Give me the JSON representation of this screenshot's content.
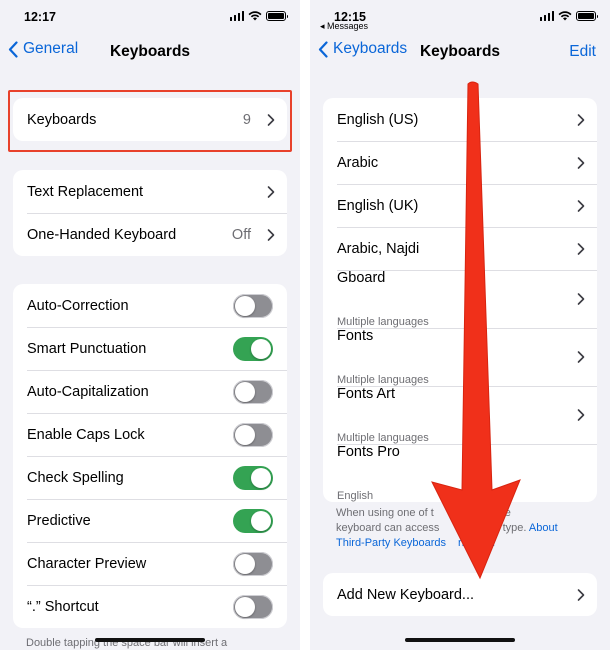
{
  "left": {
    "status_time": "12:17",
    "back_label": "General",
    "title": "Keyboards",
    "keyboards_row": {
      "label": "Keyboards",
      "value": "9"
    },
    "group2": [
      {
        "label": "Text Replacement",
        "value": ""
      },
      {
        "label": "One-Handed Keyboard",
        "value": "Off"
      }
    ],
    "toggles": [
      {
        "label": "Auto-Correction",
        "on": false
      },
      {
        "label": "Smart Punctuation",
        "on": true
      },
      {
        "label": "Auto-Capitalization",
        "on": false
      },
      {
        "label": "Enable Caps Lock",
        "on": false
      },
      {
        "label": "Check Spelling",
        "on": true
      },
      {
        "label": "Predictive",
        "on": true
      },
      {
        "label": "Character Preview",
        "on": false
      },
      {
        "label": "“.” Shortcut",
        "on": false
      }
    ],
    "footer_text": "Double tapping the space bar will insert a"
  },
  "right": {
    "status_time": "12:15",
    "status_sub": "◂ Messages",
    "back_label": "Keyboards",
    "title": "Keyboards",
    "edit_label": "Edit",
    "keyboards": [
      {
        "name": "English (US)",
        "sub": ""
      },
      {
        "name": "Arabic",
        "sub": ""
      },
      {
        "name": "English (UK)",
        "sub": ""
      },
      {
        "name": "Arabic, Najdi",
        "sub": ""
      },
      {
        "name": "Gboard",
        "sub": "Multiple languages"
      },
      {
        "name": "Fonts",
        "sub": "Multiple languages"
      },
      {
        "name": "Fonts Art",
        "sub": "Multiple languages"
      },
      {
        "name": "Fonts Pro",
        "sub": "English"
      }
    ],
    "footer_line1": "When using one of t",
    "footer_line1b": "boards, the",
    "footer_line2": "keyboard can access",
    "footer_line2b": "data you type.",
    "footer_link_about": "About",
    "footer_link": "Third-Party Keyboards",
    "footer_link_end": "rivacy...",
    "add_label": "Add New Keyboard..."
  },
  "colors": {
    "accent": "#0a66d8",
    "toggle_on": "#34a353",
    "annotation": "#e8412b"
  }
}
